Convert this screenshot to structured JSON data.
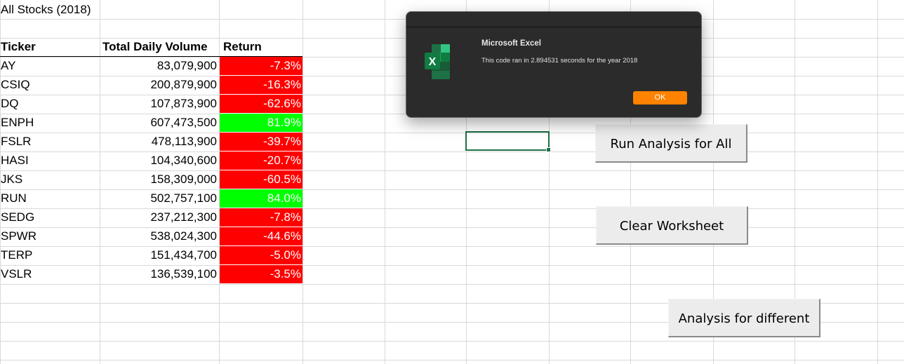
{
  "sheet": {
    "title": "All Stocks (2018)",
    "headers": {
      "ticker": "Ticker",
      "volume": "Total Daily Volume",
      "return": "Return"
    },
    "rows": [
      {
        "ticker": "AY",
        "volume": "83,079,900",
        "return": "-7.3%",
        "positive": false
      },
      {
        "ticker": "CSIQ",
        "volume": "200,879,900",
        "return": "-16.3%",
        "positive": false
      },
      {
        "ticker": "DQ",
        "volume": "107,873,900",
        "return": "-62.6%",
        "positive": false
      },
      {
        "ticker": "ENPH",
        "volume": "607,473,500",
        "return": "81.9%",
        "positive": true
      },
      {
        "ticker": "FSLR",
        "volume": "478,113,900",
        "return": "-39.7%",
        "positive": false
      },
      {
        "ticker": "HASI",
        "volume": "104,340,600",
        "return": "-20.7%",
        "positive": false
      },
      {
        "ticker": "JKS",
        "volume": "158,309,000",
        "return": "-60.5%",
        "positive": false
      },
      {
        "ticker": "RUN",
        "volume": "502,757,100",
        "return": "84.0%",
        "positive": true
      },
      {
        "ticker": "SEDG",
        "volume": "237,212,300",
        "return": "-7.8%",
        "positive": false
      },
      {
        "ticker": "SPWR",
        "volume": "538,024,300",
        "return": "-44.6%",
        "positive": false
      },
      {
        "ticker": "TERP",
        "volume": "151,434,700",
        "return": "-5.0%",
        "positive": false
      },
      {
        "ticker": "VSLR",
        "volume": "136,539,100",
        "return": "-3.5%",
        "positive": false
      }
    ],
    "colors": {
      "negative": "#ff0000",
      "positive": "#00ff00"
    }
  },
  "buttons": {
    "run_all": "Run Analysis for All",
    "clear": "Clear Worksheet",
    "different": "Analysis for different"
  },
  "dialog": {
    "title": "Microsoft Excel",
    "message": "This code ran in 2.894531 seconds for the year 2018",
    "ok": "OK",
    "icon": "excel-app-icon",
    "ok_color": "#ff8200"
  }
}
